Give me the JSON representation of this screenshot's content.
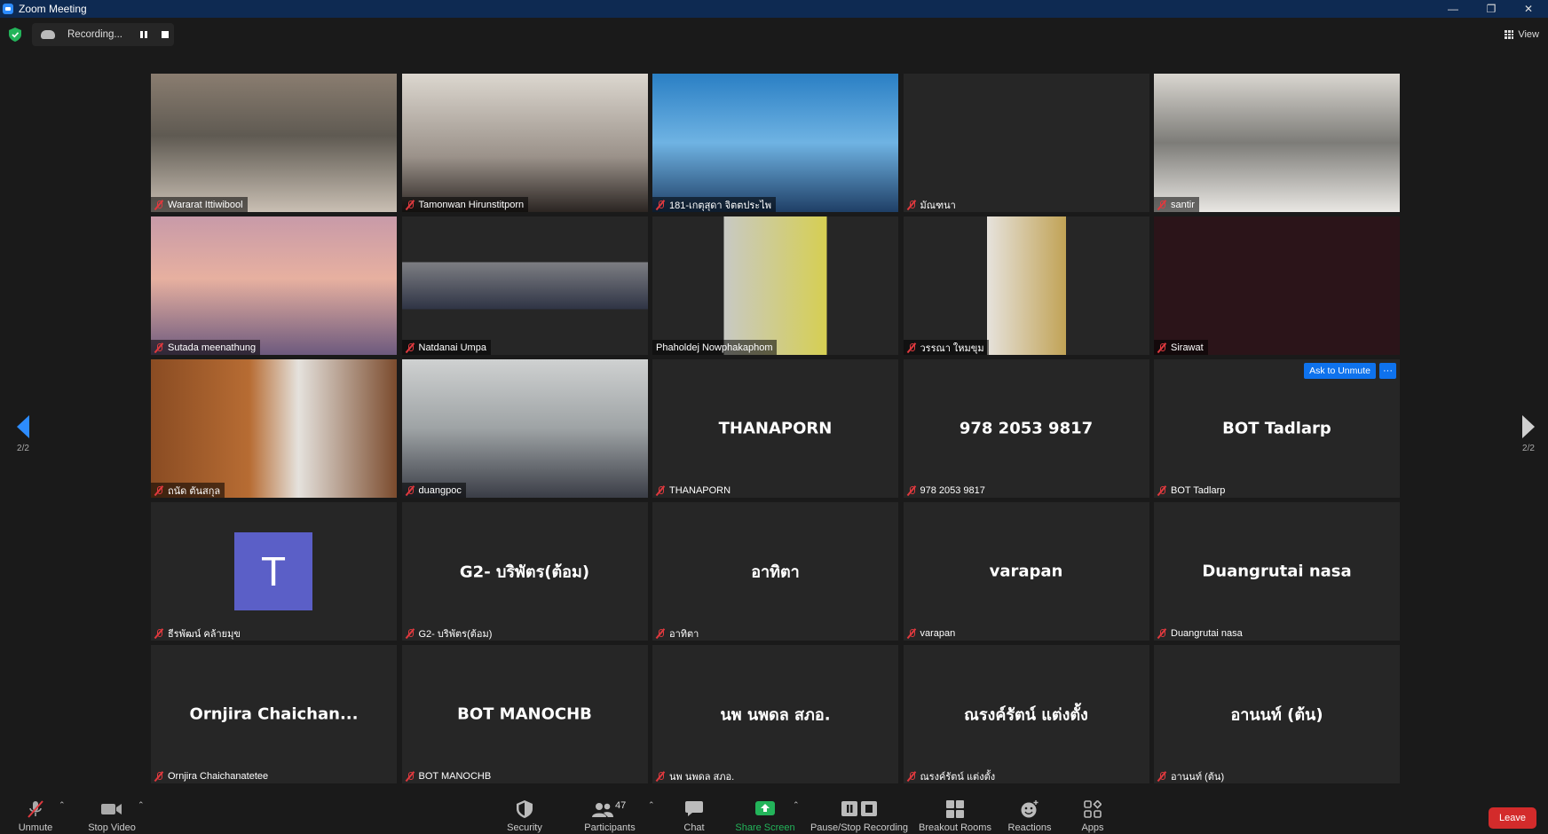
{
  "window": {
    "title": "Zoom Meeting"
  },
  "recording": {
    "label": "Recording..."
  },
  "view": {
    "label": "View"
  },
  "pagination": {
    "left": "2/2",
    "right": "2/2"
  },
  "tile_actions": {
    "ask_to_unmute": "Ask to Unmute",
    "more": "···"
  },
  "tiles": [
    {
      "name": "Wararat Ittiwibool",
      "big": "",
      "video": true,
      "muted": true,
      "avatar": ""
    },
    {
      "name": "Tamonwan Hirunstitporn",
      "big": "",
      "video": true,
      "muted": true,
      "avatar": ""
    },
    {
      "name": "181-เกตุสุดา จิตตประไพ",
      "big": "",
      "video": true,
      "muted": true,
      "avatar": ""
    },
    {
      "name": "มัณฑนา",
      "big": "",
      "video": false,
      "muted": true,
      "avatar": ""
    },
    {
      "name": "santir",
      "big": "",
      "video": true,
      "muted": true,
      "avatar": ""
    },
    {
      "name": "Sutada meenathung",
      "big": "",
      "video": true,
      "muted": true,
      "avatar": ""
    },
    {
      "name": "Natdanai Umpa",
      "big": "",
      "video": true,
      "muted": true,
      "avatar": ""
    },
    {
      "name": "Phaholdej Nowphakaphom",
      "big": "",
      "video": true,
      "muted": false,
      "avatar": ""
    },
    {
      "name": "วรรณา ใหมขุม",
      "big": "",
      "video": true,
      "muted": true,
      "avatar": ""
    },
    {
      "name": "Sirawat",
      "big": "",
      "video": true,
      "muted": true,
      "avatar": ""
    },
    {
      "name": "ถนัด ตันสกุล",
      "big": "",
      "video": true,
      "muted": true,
      "avatar": ""
    },
    {
      "name": "duangpoc",
      "big": "",
      "video": true,
      "muted": true,
      "avatar": ""
    },
    {
      "name": "THANAPORN",
      "big": "THANAPORN",
      "video": false,
      "muted": true,
      "avatar": ""
    },
    {
      "name": "978 2053 9817",
      "big": "978 2053 9817",
      "video": false,
      "muted": true,
      "avatar": ""
    },
    {
      "name": "BOT Tadlarp",
      "big": "BOT Tadlarp",
      "video": false,
      "muted": true,
      "avatar": ""
    },
    {
      "name": "ธีรพัฒน์ คล้ายมุข",
      "big": "",
      "video": false,
      "muted": true,
      "avatar": "T"
    },
    {
      "name": "G2- บริพัตร(ต้อม)",
      "big": "G2- บริพัตร(ต้อม)",
      "video": false,
      "muted": true,
      "avatar": ""
    },
    {
      "name": "อาทิตา",
      "big": "อาทิตา",
      "video": false,
      "muted": true,
      "avatar": ""
    },
    {
      "name": "varapan",
      "big": "varapan",
      "video": false,
      "muted": true,
      "avatar": ""
    },
    {
      "name": "Duangrutai nasa",
      "big": "Duangrutai nasa",
      "video": false,
      "muted": true,
      "avatar": ""
    },
    {
      "name": "Ornjira Chaichanatetee",
      "big": "Ornjira  Chaichan...",
      "video": false,
      "muted": true,
      "avatar": ""
    },
    {
      "name": "BOT MANOCHB",
      "big": "BOT MANOCHB",
      "video": false,
      "muted": true,
      "avatar": ""
    },
    {
      "name": "นพ นพดล สภอ.",
      "big": "นพ นพดล สภอ.",
      "video": false,
      "muted": true,
      "avatar": ""
    },
    {
      "name": "ณรงค์รัตน์ แต่งตั้ง",
      "big": "ณรงค์รัตน์ แต่งตั้ง",
      "video": false,
      "muted": true,
      "avatar": ""
    },
    {
      "name": "อานนท์ (ต้น)",
      "big": "อานนท์ (ต้น)",
      "video": false,
      "muted": true,
      "avatar": ""
    }
  ],
  "toolbar": {
    "unmute": "Unmute",
    "stop_video": "Stop Video",
    "security": "Security",
    "participants": "Participants",
    "participants_count": "47",
    "chat": "Chat",
    "share_screen": "Share Screen",
    "pause_stop_recording": "Pause/Stop Recording",
    "breakout_rooms": "Breakout Rooms",
    "reactions": "Reactions",
    "apps": "Apps",
    "leave": "Leave"
  },
  "colors": {
    "accent": "#2d8cff",
    "share_green": "#23b45a",
    "leave_red": "#d32b2b",
    "muted_red": "#e0393e"
  }
}
